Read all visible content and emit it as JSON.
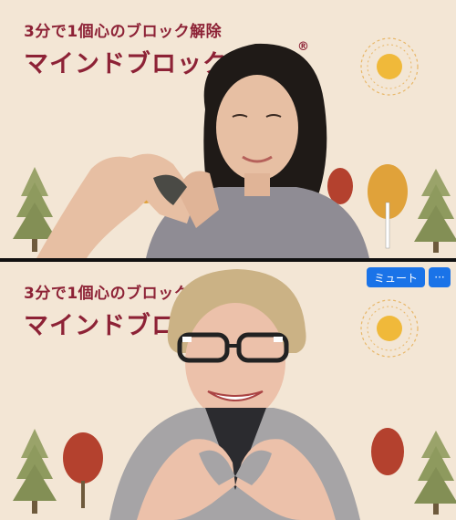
{
  "tiles": [
    {
      "subtitle": "3分で1個心のブロック解除",
      "title": "マインドブロックバ",
      "registered_mark": "®"
    },
    {
      "subtitle": "3分で1個心のブロック",
      "title": "マインドブロッ",
      "controls": {
        "mute_label": "ミュート",
        "more_label": "···"
      }
    }
  ],
  "colors": {
    "background": "#f3e6d5",
    "title": "#8d2236",
    "button": "#1a73e8"
  }
}
